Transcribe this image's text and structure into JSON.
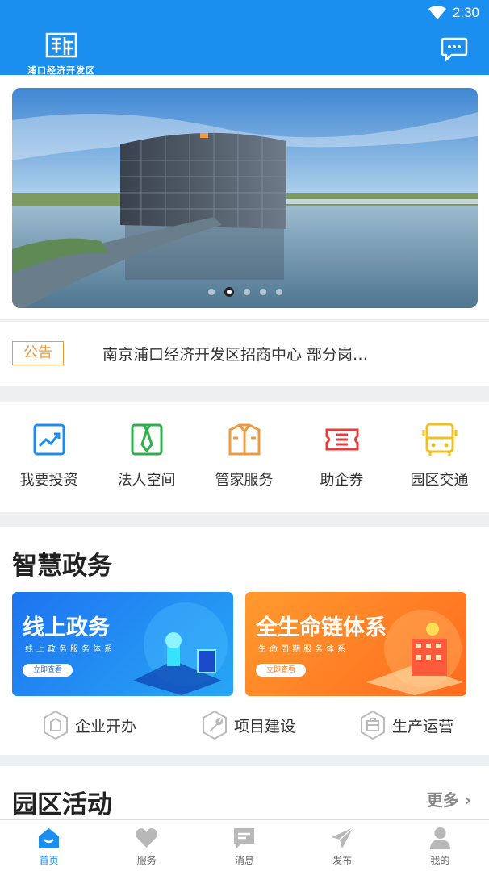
{
  "status_bar": {
    "time": "2:30"
  },
  "header": {
    "logo_text": "浦口经济开发区",
    "colors": {
      "primary": "#1a8ff0"
    }
  },
  "banner": {
    "slide_count": 5,
    "active_index": 1
  },
  "notice": {
    "tag": "公告",
    "text": "南京浦口经济开发区招商中心 部分岗…"
  },
  "quick_actions": [
    {
      "label": "我要投资",
      "icon": "investment-chart-icon",
      "color": "#1a8ff0"
    },
    {
      "label": "法人空间",
      "icon": "tie-icon",
      "color": "#2bb14a"
    },
    {
      "label": "管家服务",
      "icon": "butler-suit-icon",
      "color": "#f29a3b"
    },
    {
      "label": "助企券",
      "icon": "ticket-icon",
      "color": "#e83b3b"
    },
    {
      "label": "园区交通",
      "icon": "bus-icon",
      "color": "#f2c01e"
    }
  ],
  "smart_gov": {
    "title": "智慧政务",
    "cards": [
      {
        "title": "线上政务",
        "subtitle": "线上政务服务体系",
        "button": "立即查看"
      },
      {
        "title": "全生命链体系",
        "subtitle": "生命周期服务体系",
        "button": "立即查看"
      }
    ],
    "sub_links": [
      {
        "label": "企业开办",
        "icon": "enterprise-shield-icon"
      },
      {
        "label": "项目建设",
        "icon": "wrench-shield-icon"
      },
      {
        "label": "生产运营",
        "icon": "factory-shield-icon"
      }
    ]
  },
  "activities": {
    "title": "园区活动",
    "more": "更多"
  },
  "tabbar": [
    {
      "label": "首页",
      "icon": "home-icon",
      "active": true
    },
    {
      "label": "服务",
      "icon": "heart-icon",
      "active": false
    },
    {
      "label": "消息",
      "icon": "message-icon",
      "active": false
    },
    {
      "label": "发布",
      "icon": "send-icon",
      "active": false
    },
    {
      "label": "我的",
      "icon": "user-icon",
      "active": false
    }
  ]
}
